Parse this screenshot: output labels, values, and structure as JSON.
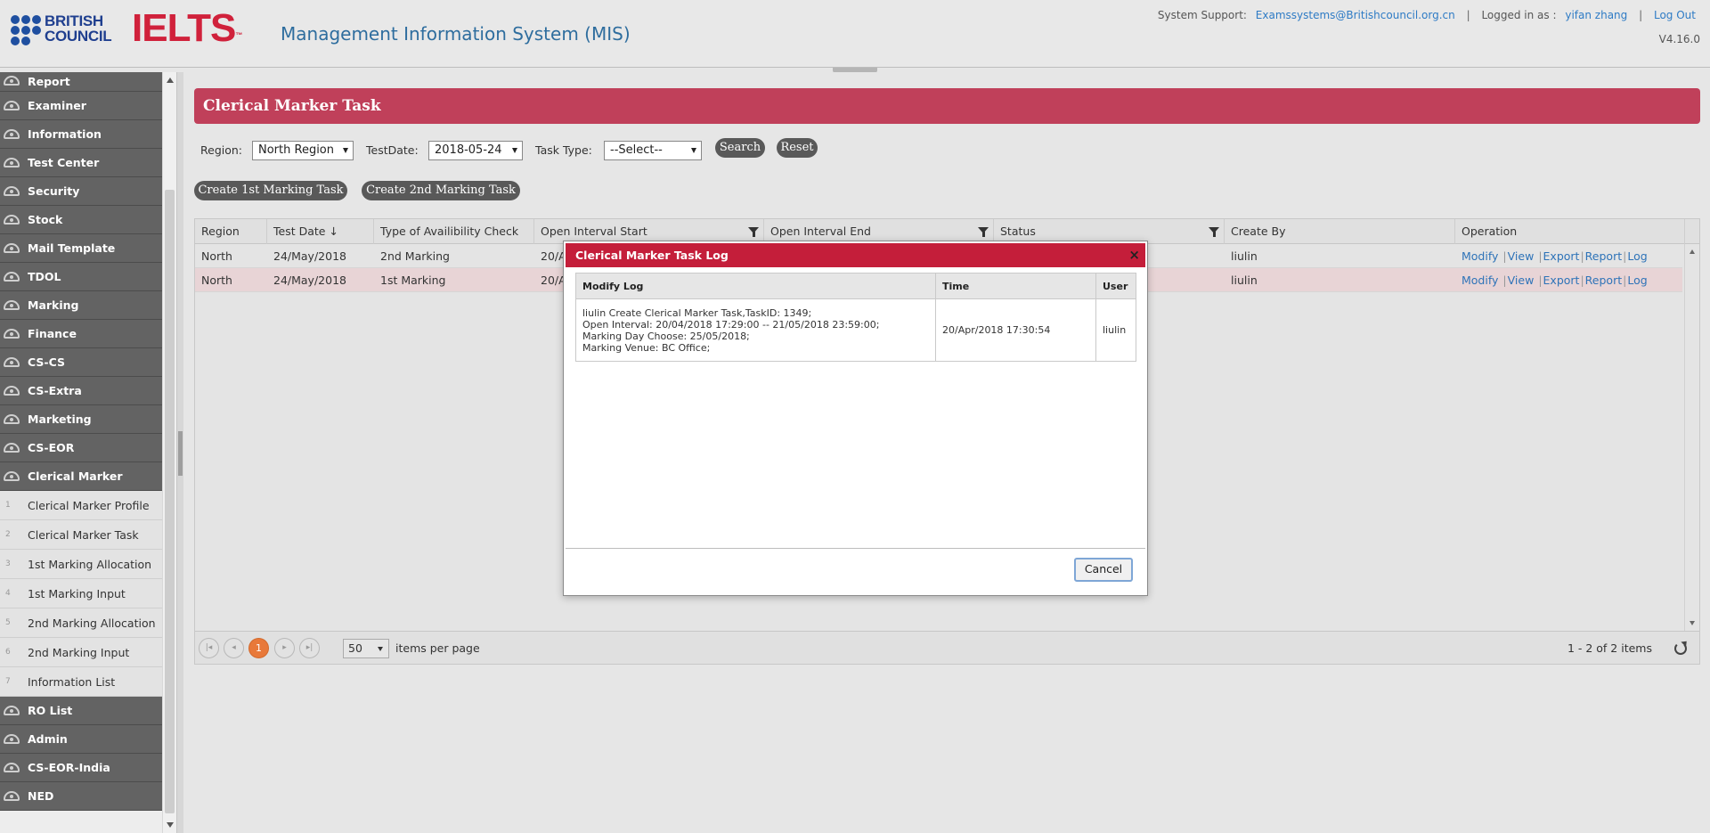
{
  "header": {
    "brand": {
      "line1": "BRITISH",
      "line2": "COUNCIL"
    },
    "ielts": "IELTS",
    "trademark": "™",
    "system_title": "Management Information System (MIS)",
    "support_label": "System Support:",
    "support_email": "Examssystems@Britishcouncil.org.cn",
    "logged_in_label": "Logged in as :",
    "user": "yifan zhang",
    "logout": "Log Out",
    "version": "V4.16.0",
    "separator": "|"
  },
  "sidebar": {
    "top_items": [
      "Report",
      "Examiner",
      "Information Management",
      "Test Center",
      "Security",
      "Stock",
      "Mail Template",
      "TDOL",
      "Marking",
      "Finance",
      "CS-CS",
      "CS-Extra",
      "Marketing",
      "CS-EOR",
      "Clerical Marker"
    ],
    "sub_items": [
      {
        "num": "1",
        "label": "Clerical Marker Profile"
      },
      {
        "num": "2",
        "label": "Clerical Marker Task"
      },
      {
        "num": "3",
        "label": "1st Marking Allocation"
      },
      {
        "num": "4",
        "label": "1st Marking Input"
      },
      {
        "num": "5",
        "label": "2nd Marking Allocation"
      },
      {
        "num": "6",
        "label": "2nd Marking Input"
      },
      {
        "num": "7",
        "label": "Information List"
      }
    ],
    "bottom_items": [
      "RO List",
      "Admin",
      "CS-EOR-India",
      "NED"
    ]
  },
  "page": {
    "title": "Clerical Marker Task",
    "filters": {
      "region_label": "Region:",
      "region_value": "North Region",
      "testdate_label": "TestDate:",
      "testdate_value": "2018-05-24",
      "tasktype_label": "Task Type:",
      "tasktype_value": "--Select--"
    },
    "search_label": "Search",
    "reset_label": "Reset",
    "create_first_label": "Create 1st Marking Task",
    "create_second_label": "Create 2nd Marking Task"
  },
  "grid": {
    "columns": [
      "Region",
      "Test Date ↓",
      "Type of Availibility Check",
      "Open Interval Start",
      "Open Interval End",
      "Status",
      "Create By",
      "Operation"
    ],
    "rows": [
      {
        "region": "North",
        "test_date": "24/May/2018",
        "type": "2nd Marking",
        "start": "20/A",
        "create_by": "liulin"
      },
      {
        "region": "North",
        "test_date": "24/May/2018",
        "type": "1st Marking",
        "start": "20/A",
        "create_by": "liulin"
      }
    ],
    "operations": [
      "Modify",
      "View",
      "Export",
      "Report",
      "Log"
    ],
    "op_separator": "|",
    "pager": {
      "first": "|◂",
      "prev": "◂",
      "current_page": "1",
      "next": "▸",
      "last": "▸|",
      "page_size": "50",
      "per_page_label": "items per page",
      "summary": "1 - 2 of 2 items"
    }
  },
  "modal": {
    "title": "Clerical Marker Task Log",
    "close": "×",
    "columns": [
      "Modify Log",
      "Time",
      "User"
    ],
    "log_lines": [
      "liulin Create Clerical Marker Task,TaskID: 1349;",
      "Open Interval: 20/04/2018 17:29:00 -- 21/05/2018 23:59:00;",
      "Marking Day Choose: 25/05/2018;",
      "Marking Venue: BC Office;"
    ],
    "time": "20/Apr/2018 17:30:54",
    "user": "liulin",
    "cancel_label": "Cancel"
  },
  "colors": {
    "banner": "#c0405a",
    "modal_title": "#c41e3a",
    "sidebar_dark": "#636363",
    "link": "#2e73b8",
    "pager_active": "#e8793a",
    "ielts_red": "#d0213b"
  }
}
